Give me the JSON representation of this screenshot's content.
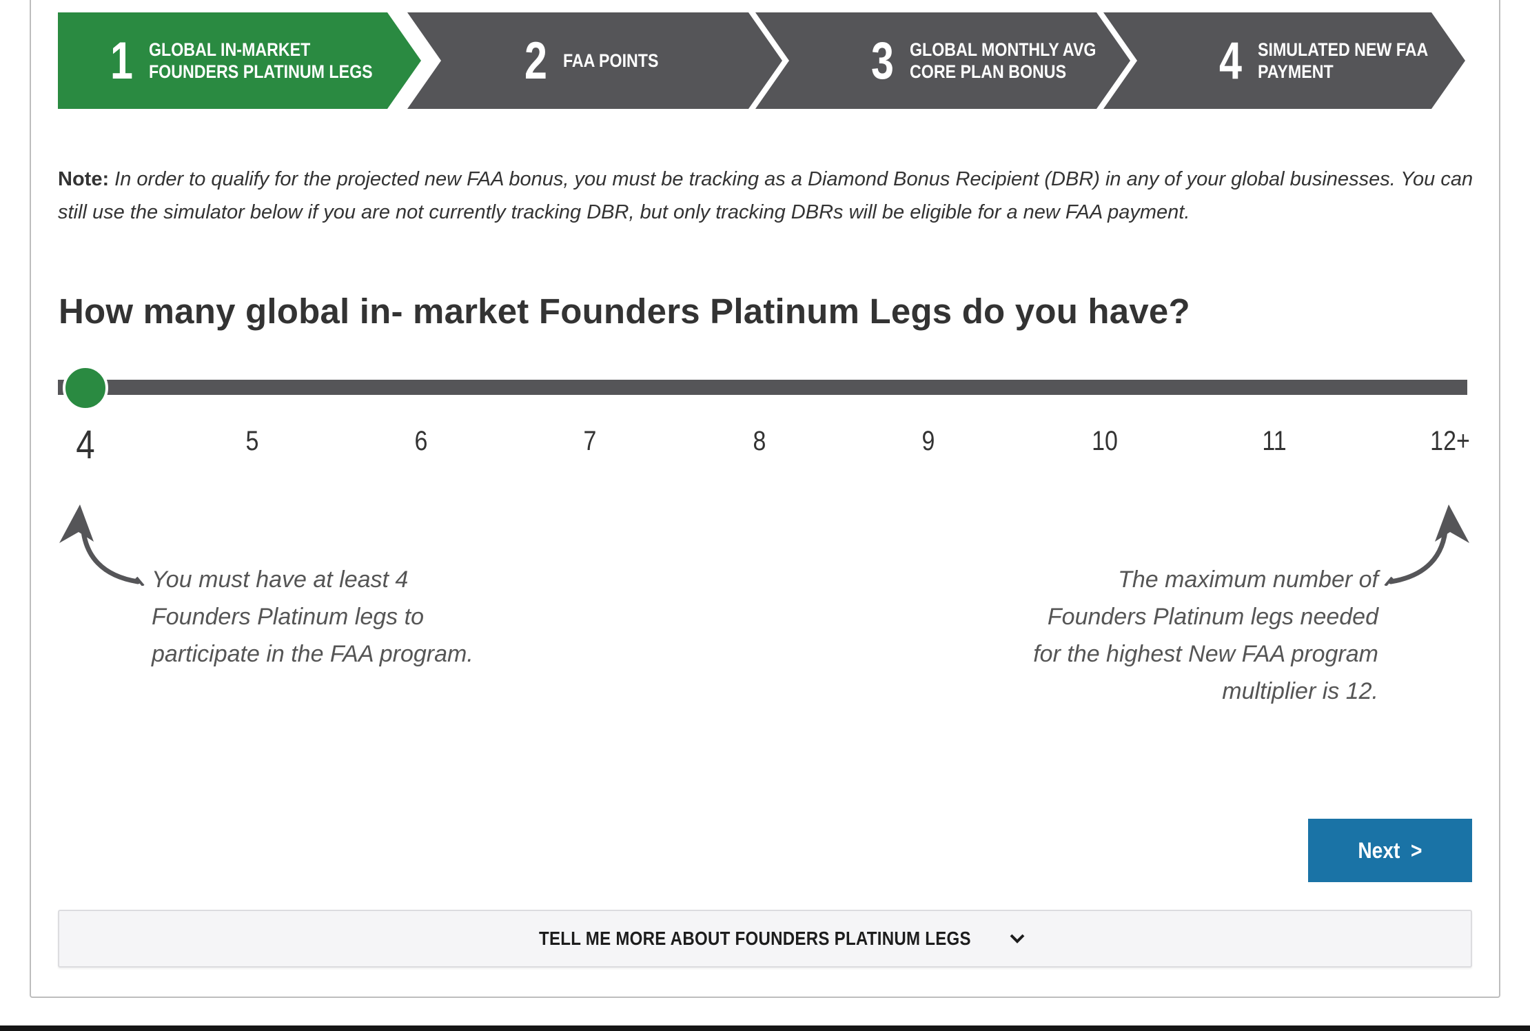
{
  "stepper": {
    "steps": [
      {
        "number": "1",
        "label_line1": "GLOBAL IN-MARKET",
        "label_line2": "FOUNDERS PLATINUM LEGS",
        "active": true
      },
      {
        "number": "2",
        "label_line1": "FAA POINTS",
        "label_line2": "",
        "active": false
      },
      {
        "number": "3",
        "label_line1": "GLOBAL MONTHLY AVG",
        "label_line2": "CORE PLAN BONUS",
        "active": false
      },
      {
        "number": "4",
        "label_line1": "SIMULATED NEW FAA",
        "label_line2": "PAYMENT",
        "active": false
      }
    ]
  },
  "note": {
    "label": "Note:",
    "text": "In order to qualify for the projected new FAA bonus, you must be tracking as a Diamond Bonus Recipient (DBR) in any of your global businesses. You can still use the simulator below if you are not currently tracking DBR, but only tracking DBRs will be eligible for a new FAA payment."
  },
  "question": "How many global in- market Founders Platinum Legs do you have?",
  "slider": {
    "ticks": [
      "4",
      "5",
      "6",
      "7",
      "8",
      "9",
      "10",
      "11",
      "12+"
    ],
    "selected": "4",
    "selected_index": 0
  },
  "hints": {
    "left": "You must have at least 4 Founders Platinum legs to participate in the FAA program.",
    "right": "The maximum number of Founders Platinum legs needed for the highest New FAA program multiplier is 12."
  },
  "next_button": {
    "label": "Next  >"
  },
  "more": {
    "label": "TELL ME MORE ABOUT FOUNDERS PLATINUM LEGS",
    "icon": "chevron-down-icon"
  },
  "colors": {
    "active_step": "#2a8a41",
    "inactive_step": "#555558",
    "slider_thumb": "#2a8a41",
    "slider_track": "#555558",
    "next_button": "#1a73a6"
  }
}
